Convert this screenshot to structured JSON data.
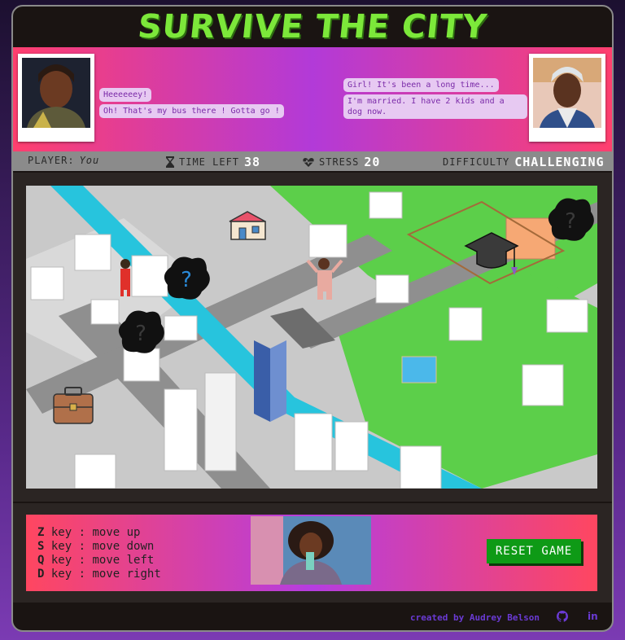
{
  "title": "SURVIVE THE CITY",
  "chat_left": [
    "Heeeeeey!",
    "Oh! That's my bus there ! Gotta go !"
  ],
  "chat_right": [
    "Girl! It's been a long time...",
    "I'm married. I have 2 kids and a dog now."
  ],
  "status": {
    "player_label": "PLAYER:",
    "player_value": "You",
    "time_label": "TIME LEFT",
    "time_value": "38",
    "stress_label": "STRESS",
    "stress_value": "20",
    "difficulty_label": "DIFFICULTY",
    "difficulty_value": "CHALLENGING"
  },
  "map_icons": {
    "unknown_mark": "?"
  },
  "controls": [
    {
      "key": "Z",
      "sep": "key :",
      "action": "move up"
    },
    {
      "key": "S",
      "sep": "key :",
      "action": "move down"
    },
    {
      "key": "Q",
      "sep": "key :",
      "action": "move left"
    },
    {
      "key": "D",
      "sep": "key :",
      "action": "move right"
    }
  ],
  "reset_label": "RESET GAME",
  "footer": {
    "credit": "created by Audrey Belson",
    "linkedin": "in"
  },
  "colors": {
    "title_green": "#7ce83a",
    "accent_pink": "#ff3f6e",
    "accent_purple": "#b23ad8",
    "button_green": "#0e9a16"
  }
}
